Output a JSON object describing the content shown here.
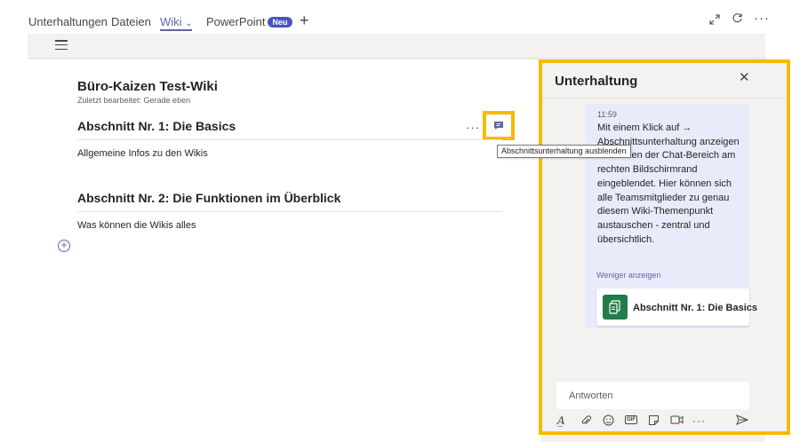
{
  "tabs": [
    {
      "label": "Unterhaltungen"
    },
    {
      "label": "Dateien"
    },
    {
      "label": "Wiki",
      "active": true
    },
    {
      "label": "PowerPoint",
      "badge": "Neu"
    }
  ],
  "tab_icons": {
    "dropdown": "chevron-down-icon",
    "add": "plus-icon",
    "expand": "expand-icon",
    "refresh": "refresh-icon",
    "more": "more-icon"
  },
  "wiki": {
    "title": "Büro-Kaizen Test-Wiki",
    "subtitle": "Zuletzt bearbeitet: Gerade eben",
    "sections": [
      {
        "title": "Abschnitt Nr. 1: Die Basics",
        "body": "Allgemeine Infos zu den Wikis"
      },
      {
        "title": "Abschnitt Nr. 2: Die Funktionen im Überblick",
        "body": "Was können die Wikis alles"
      }
    ],
    "more": "···",
    "tooltip": "Abschnittsunterhaltung ausblenden"
  },
  "panel": {
    "title": "Unterhaltung",
    "close": "✕",
    "message": {
      "time": "11:59",
      "text": "Mit einem Klick auf → Abschnittsunterhaltung anzeigen wird Ihnen der Chat-Bereich am rechten Bildschirmrand eingeblendet. Hier können sich alle Teamsmitglieder zu genau diesem Wiki-Themenpunkt austauschen - zentral und übersichtlich.",
      "show_less": "Weniger anzeigen",
      "card_label": "Abschnitt Nr. 1: Die Basics"
    },
    "reply_placeholder": "Antworten",
    "compose_gif": "GIF"
  },
  "colors": {
    "accent": "#6264a7",
    "highlight": "#f5bb00",
    "card_icon": "#237b4b"
  }
}
